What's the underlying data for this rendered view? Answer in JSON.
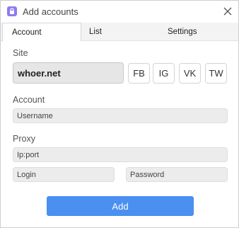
{
  "window": {
    "title": "Add accounts",
    "icons": {
      "app": "lock-icon",
      "close": "close-icon"
    }
  },
  "tabs": [
    {
      "label": "Account",
      "active": true
    },
    {
      "label": "List",
      "active": false
    },
    {
      "label": "Settings",
      "active": false
    }
  ],
  "site": {
    "label": "Site",
    "value": "whoer.net",
    "buttons": [
      "FB",
      "IG",
      "VK",
      "TW"
    ]
  },
  "account": {
    "label": "Account",
    "username_placeholder": "Username"
  },
  "proxy": {
    "label": "Proxy",
    "ipport_placeholder": "Ip:port",
    "login_placeholder": "Login",
    "password_placeholder": "Password"
  },
  "actions": {
    "add_label": "Add"
  },
  "colors": {
    "accent": "#4b8ff0",
    "app_icon": "#8c7cf0"
  }
}
